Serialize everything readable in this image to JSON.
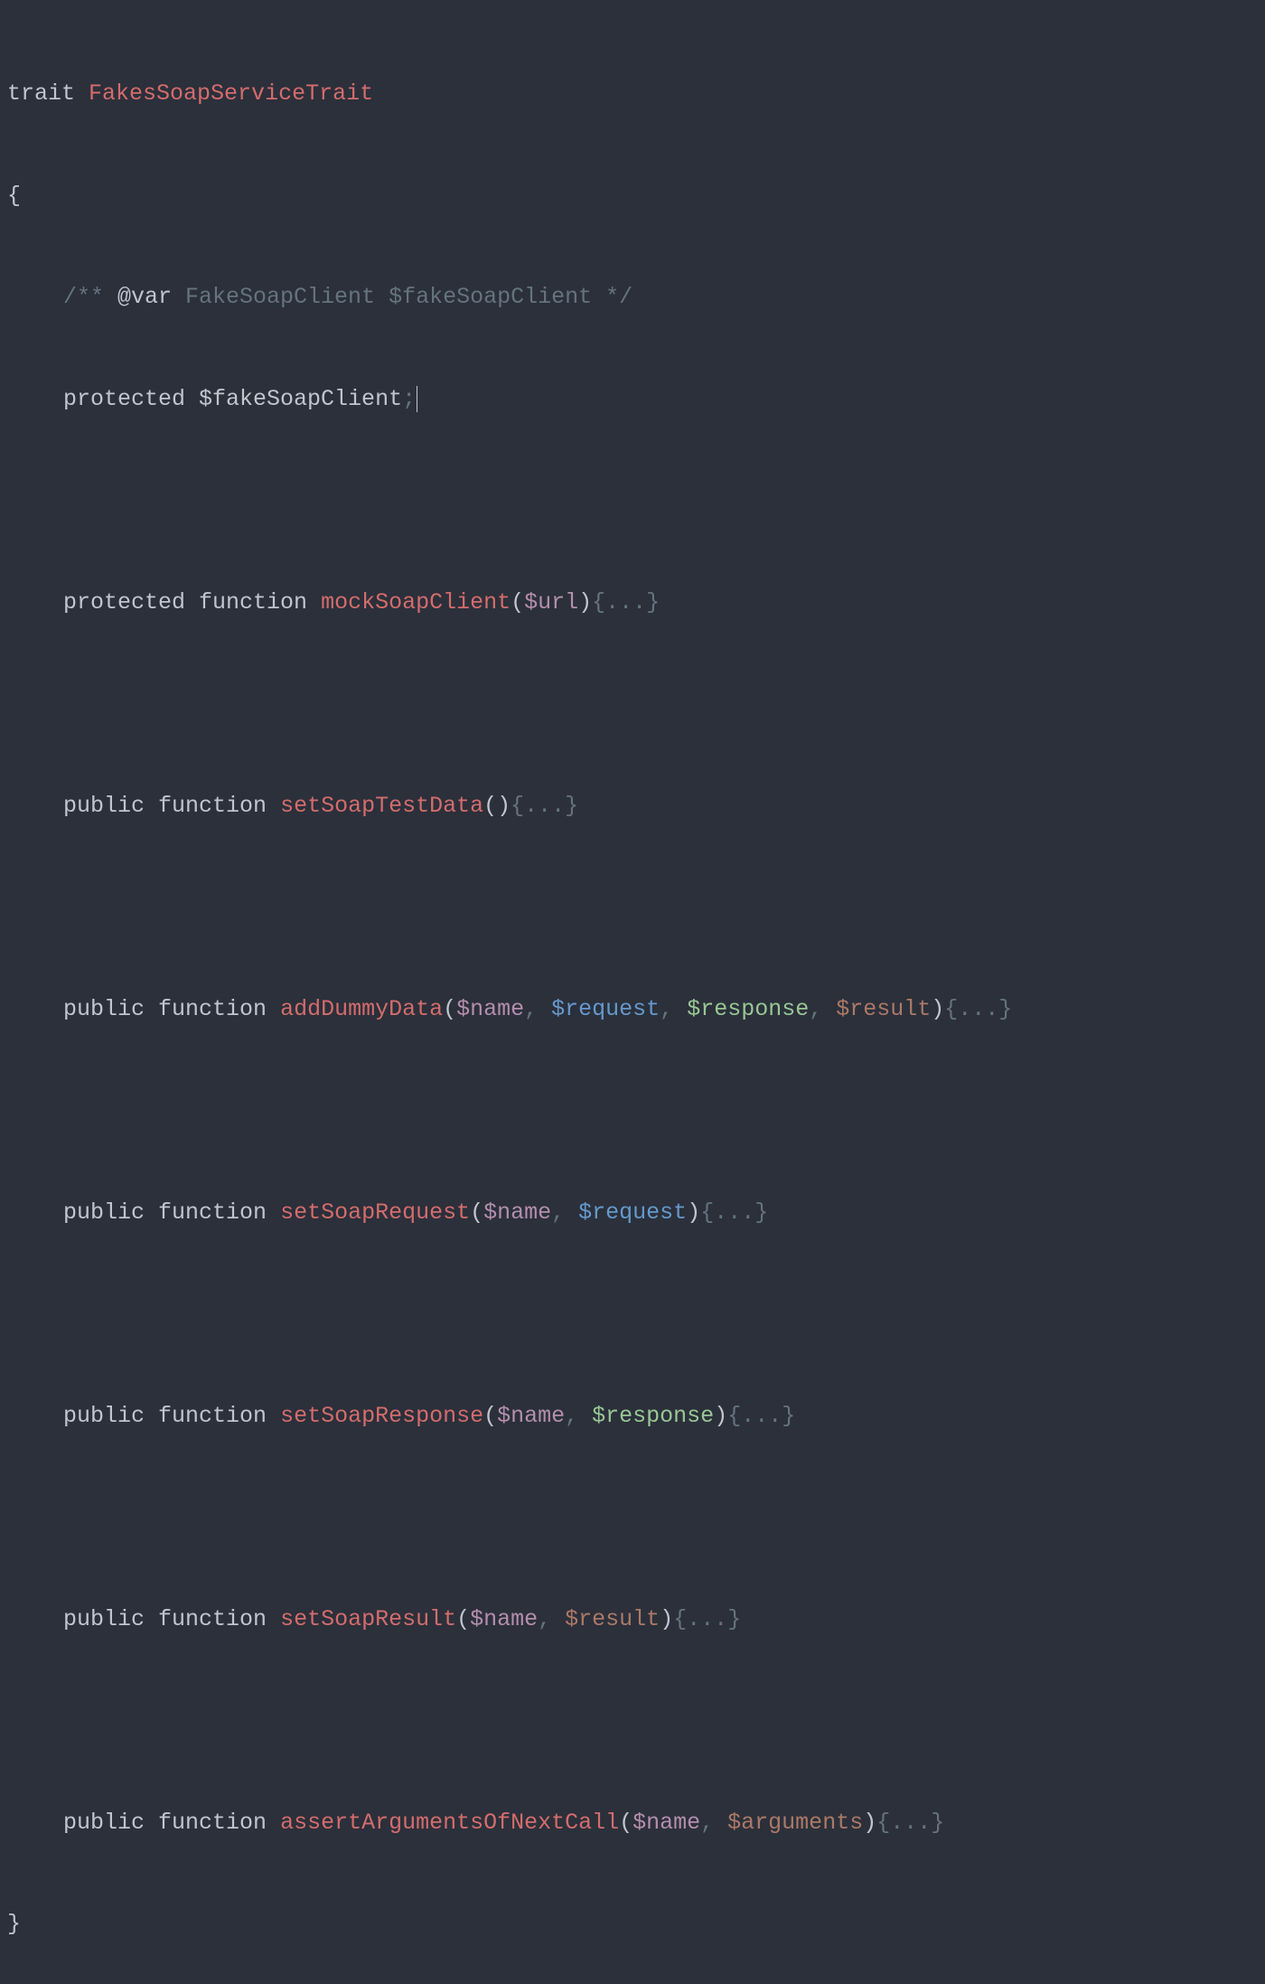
{
  "trait_keyword": "trait",
  "trait_name": "FakesSoapServiceTrait",
  "open_brace": "{",
  "close_brace": "}",
  "doc_comment": {
    "open": "/** ",
    "tag": "@var ",
    "type": "FakeSoapClient ",
    "var": "$fakeSoapClient ",
    "close": "*/"
  },
  "protected_kw": "protected ",
  "public_kw": "public ",
  "function_kw": "function ",
  "property_var": "$fakeSoapClient",
  "semicolon": ";",
  "methods": {
    "mockSoapClient": {
      "name": "mockSoapClient",
      "params": [
        {
          "text": "$url",
          "style": "var-purple"
        }
      ]
    },
    "setSoapTestData": {
      "name": "setSoapTestData",
      "params": []
    },
    "addDummyData": {
      "name": "addDummyData",
      "params": [
        {
          "text": "$name",
          "style": "var-purple"
        },
        {
          "text": "$request",
          "style": "var-blue"
        },
        {
          "text": "$response",
          "style": "var-green"
        },
        {
          "text": "$result",
          "style": "var-brown"
        }
      ]
    },
    "setSoapRequest": {
      "name": "setSoapRequest",
      "params": [
        {
          "text": "$name",
          "style": "var-purple"
        },
        {
          "text": "$request",
          "style": "var-blue"
        }
      ]
    },
    "setSoapResponse": {
      "name": "setSoapResponse",
      "params": [
        {
          "text": "$name",
          "style": "var-purple"
        },
        {
          "text": "$response",
          "style": "var-green"
        }
      ]
    },
    "setSoapResult": {
      "name": "setSoapResult",
      "params": [
        {
          "text": "$name",
          "style": "var-purple"
        },
        {
          "text": "$result",
          "style": "var-brown"
        }
      ]
    },
    "assertArgumentsOfNextCall": {
      "name": "assertArgumentsOfNextCall",
      "params": [
        {
          "text": "$name",
          "style": "var-purple"
        },
        {
          "text": "$arguments",
          "style": "var-brown"
        }
      ]
    }
  },
  "paren_open": "(",
  "paren_close": ")",
  "folded": "{...}",
  "comma": ", "
}
